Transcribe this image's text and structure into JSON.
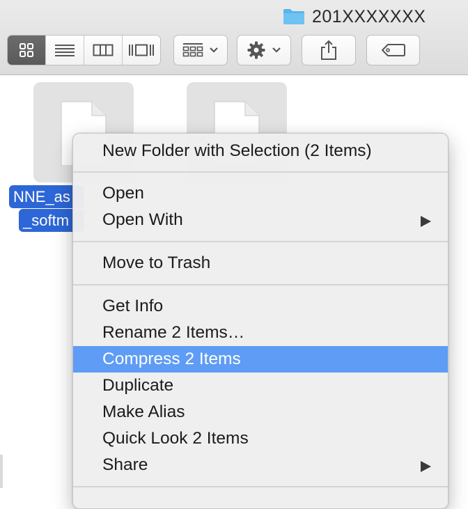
{
  "window": {
    "title": "201XXXXXXX"
  },
  "toolbar": {
    "view_buttons": [
      {
        "name": "icon-view",
        "icon": "grid-icon",
        "active": true
      },
      {
        "name": "list-view",
        "icon": "list-icon",
        "active": false
      },
      {
        "name": "column-view",
        "icon": "columns-icon",
        "active": false
      },
      {
        "name": "gallery-view",
        "icon": "gallery-icon",
        "active": false
      }
    ],
    "arrange_icon": "arrange-icon",
    "action_icon": "gear-icon",
    "share_icon": "share-icon",
    "tags_icon": "tag-icon"
  },
  "files": {
    "selected_label_line1": "NNE_as",
    "selected_label_line2": "_softm"
  },
  "context_menu": {
    "items": {
      "new_folder": "New Folder with Selection (2 Items)",
      "open": "Open",
      "open_with": "Open With",
      "move_to_trash": "Move to Trash",
      "get_info": "Get Info",
      "rename": "Rename 2 Items…",
      "compress": "Compress 2 Items",
      "duplicate": "Duplicate",
      "make_alias": "Make Alias",
      "quick_look": "Quick Look 2 Items",
      "share": "Share"
    },
    "highlighted": "compress"
  },
  "colors": {
    "highlight": "#5e9cf5",
    "selection_label": "#2d66d6",
    "folder_icon": "#5bb4ec"
  }
}
